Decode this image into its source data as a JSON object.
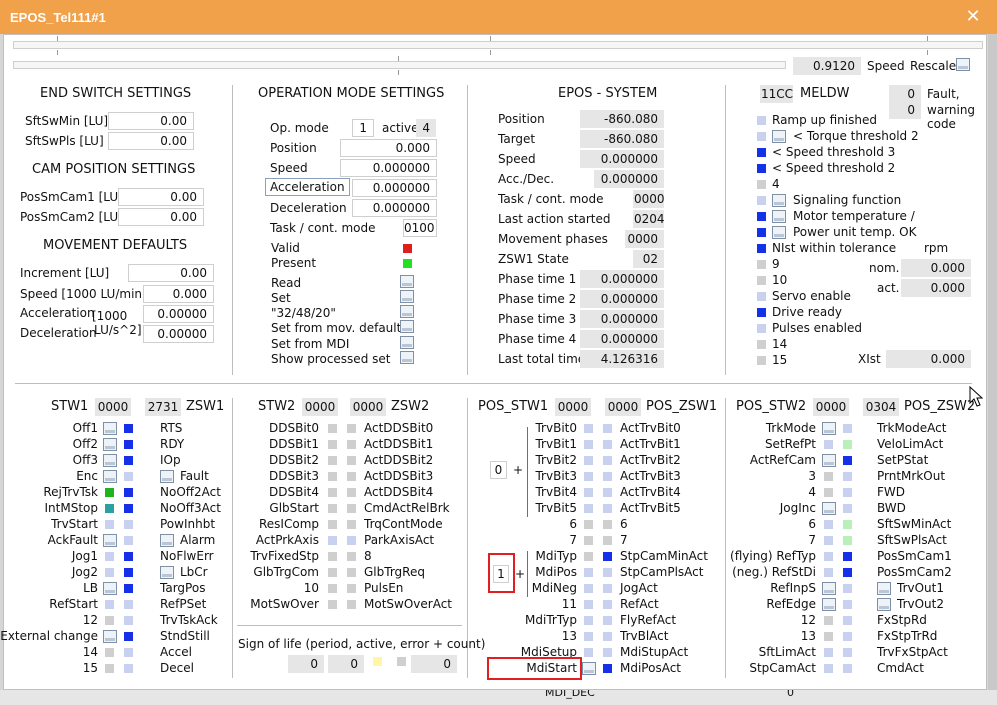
{
  "window": {
    "title": "EPOS_Tel111#1",
    "close_icon": "close-icon"
  },
  "top": {
    "speed_value": "0.9120",
    "speed_label": "Speed",
    "rescale_label": "Rescale"
  },
  "end_switch": {
    "title": "END SWITCH SETTINGS",
    "rows": [
      {
        "label": "SftSwMin [LU]",
        "value": "0.00"
      },
      {
        "label": "SftSwPls [LU]",
        "value": "0.00"
      }
    ]
  },
  "cam": {
    "title": "CAM POSITION SETTINGS",
    "rows": [
      {
        "label": "PosSmCam1 [LU]",
        "value": "0.00"
      },
      {
        "label": "PosSmCam2 [LU]",
        "value": "0.00"
      }
    ]
  },
  "movement": {
    "title": "MOVEMENT DEFAULTS",
    "increment_label": "Increment [LU]",
    "increment_value": "0.00",
    "speed_label": "Speed [1000 LU/min]",
    "speed_value": "0.000",
    "accel_label": "Acceleration",
    "decel_label": "Deceleration",
    "unit_1": "[1000",
    "unit_2": "LU/s^2]",
    "accel_value": "0.00000",
    "decel_value": "0.00000"
  },
  "opmode": {
    "title": "OPERATION MODE SETTINGS",
    "op_mode_label": "Op. mode",
    "op_mode_value": "1",
    "active_label": "active",
    "active_value": "4",
    "position_label": "Position",
    "position_value": "0.000",
    "speed_label": "Speed",
    "speed_value": "0.000000",
    "acceleration_label": "Acceleration",
    "acceleration_value": "0.000000",
    "deceleration_label": "Deceleration",
    "deceleration_value": "0.000000",
    "task_label": "Task / cont. mode",
    "task_value": "0100",
    "valid_label": "Valid",
    "present_label": "Present",
    "read_label": "Read",
    "set_label": "Set",
    "set482_label": "\"32/48/20\"",
    "set_defaults_label": "Set from mov. defaults",
    "set_mdi_label": "Set from MDI",
    "show_set_label": "Show processed set",
    "sign_label": "Sign of life (period, active, error + count)",
    "sign_period": "0",
    "sign_active": "0",
    "sign_count": "0"
  },
  "epos": {
    "title": "EPOS - SYSTEM",
    "rows": [
      {
        "label": "Position",
        "value": "-860.080"
      },
      {
        "label": "Target",
        "value": "-860.080"
      },
      {
        "label": "Speed",
        "value": "0.000000"
      },
      {
        "label": "Acc./Dec.",
        "value": "0.000000"
      },
      {
        "label": "Task / cont. mode",
        "value": "0000"
      },
      {
        "label": "Last action started",
        "value": "0204"
      },
      {
        "label": "Movement phases",
        "value": "0000"
      },
      {
        "label": "ZSW1 State",
        "value": "02"
      },
      {
        "label": "Phase time 1",
        "value": "0.000000"
      },
      {
        "label": "Phase time 2",
        "value": "0.000000"
      },
      {
        "label": "Phase time 3",
        "value": "0.000000"
      },
      {
        "label": "Phase time 4",
        "value": "0.000000"
      },
      {
        "label": "Last total time",
        "value": "4.126316"
      }
    ]
  },
  "meldw": {
    "code": "11CC",
    "title": "MELDW",
    "fault_value": "0",
    "fault_label": "Fault,",
    "warning_value": "0",
    "warning_label": "warning",
    "code_label": "code",
    "items": [
      "Ramp up finished",
      "< Torque threshold 2",
      "< Speed threshold 3",
      "< Speed threshold 2",
      "4",
      "Signaling function",
      "Motor temperature /",
      "Power unit temp. OK",
      "NIst within tolerance",
      "9",
      "10",
      "Servo enable",
      "Drive ready",
      "Pulses enabled",
      "14",
      "15"
    ],
    "rpm_label": "rpm",
    "nom_label": "nom.",
    "nom_value": "0.000",
    "act_label": "act.",
    "act_value": "0.000",
    "xist_label": "XIst",
    "xist_value": "0.000"
  },
  "stw1": {
    "left_title": "STW1",
    "left_value": "0000",
    "right_value": "2731",
    "right_title": "ZSW1",
    "left": [
      "Off1",
      "Off2",
      "Off3",
      "Enc",
      "RejTrvTsk",
      "IntMStop",
      "TrvStart",
      "AckFault",
      "Jog1",
      "Jog2",
      "LB",
      "RefStart",
      "12",
      "External change",
      "14",
      "15"
    ],
    "right": [
      "RTS",
      "RDY",
      "IOp",
      "Fault",
      "NoOff2Act",
      "NoOff3Act",
      "PowInhbt",
      "Alarm",
      "NoFlwErr",
      "LbCr",
      "TargPos",
      "RefPSet",
      "TrvTskAck",
      "StndStill",
      "Accel",
      "Decel"
    ]
  },
  "stw2": {
    "left_title": "STW2",
    "left_value": "0000",
    "right_value": "0000",
    "right_title": "ZSW2",
    "left": [
      "DDSBit0",
      "DDSBit1",
      "DDSBit2",
      "DDSBit3",
      "DDSBit4",
      "GlbStart",
      "ResIComp",
      "ActPrkAxis",
      "TrvFixedStp",
      "GlbTrgCom",
      "10",
      "MotSwOver"
    ],
    "right": [
      "ActDDSBit0",
      "ActDDSBit1",
      "ActDDSBit2",
      "ActDDSBit3",
      "ActDDSBit4",
      "CmdActRelBrk",
      "TrqContMode",
      "ParkAxisAct",
      "8",
      "GlbTrgReq",
      "PulsEn",
      "MotSwOverAct"
    ]
  },
  "pos_stw1": {
    "left_title": "POS_STW1",
    "left_value": "0000",
    "right_value": "0000",
    "right_title": "POS_ZSW1",
    "left": [
      "TrvBit0",
      "TrvBit1",
      "TrvBit2",
      "TrvBit3",
      "TrvBit4",
      "TrvBit5",
      "6",
      "7",
      "MdiTyp",
      "MdiPos",
      "MdiNeg",
      "11",
      "MdiTrTyp",
      "13",
      "MdiSetup",
      "MdiStart"
    ],
    "right": [
      "ActTrvBit0",
      "ActTrvBit1",
      "ActTrvBit2",
      "ActTrvBit3",
      "ActTrvBit4",
      "ActTrvBit5",
      "6",
      "7",
      "StpCamMinAct",
      "StpCamPlsAct",
      "JogAct",
      "RefAct",
      "FlyRefAct",
      "TrvBlAct",
      "MdiStupAct",
      "MdiPosAct"
    ],
    "sel1_value": "0",
    "sel2_value": "1",
    "plus": "+"
  },
  "pos_stw2": {
    "left_title": "POS_STW2",
    "left_value": "0000",
    "right_value": "0304",
    "right_title": "POS_ZSW2",
    "left": [
      "TrkMode",
      "SetRefPt",
      "ActRefCam",
      "3",
      "4",
      "JogInc",
      "6",
      "7",
      "(flying) RefTyp",
      "(neg.) RefStDi",
      "RefInpS",
      "RefEdge",
      "12",
      "13",
      "SftLimAct",
      "StpCamAct"
    ],
    "right": [
      "TrkModeAct",
      "VeloLimAct",
      "SetPStat",
      "PrntMrkOut",
      "FWD",
      "BWD",
      "SftSwMinAct",
      "SftSwPlsAct",
      "PosSmCam1",
      "PosSmCam2",
      "TrvOut1",
      "TrvOut2",
      "FxStpRd",
      "FxStpTrRd",
      "TrvFxStpAct",
      "CmdAct"
    ]
  },
  "background": {
    "mdi_dec_label": "MDI_DEC",
    "mdi_dec_value": "0"
  },
  "colors": {
    "title_bar": "#f0a14a",
    "accent_blue": "#1530e6",
    "alarm_red": "#e01e1e",
    "ok_green": "#22e022"
  }
}
